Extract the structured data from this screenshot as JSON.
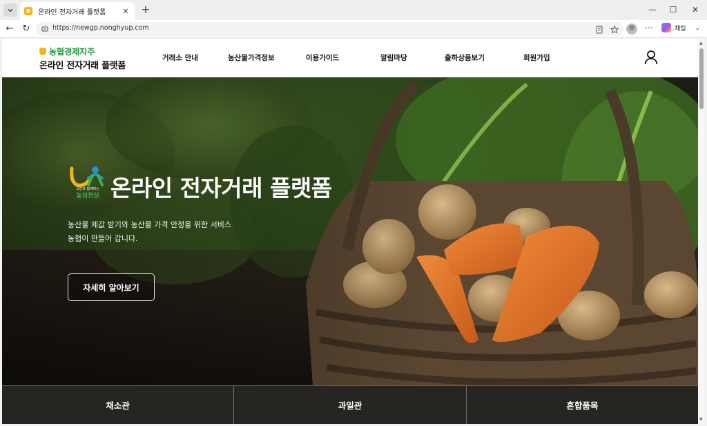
{
  "browser": {
    "tab_title": "온라인 전자거래 플랫폼",
    "url": "https://newgp.nonghyup.com",
    "copilot_label": "채팅"
  },
  "header": {
    "logo_top": "농협경제지주",
    "logo_bottom": "온라인 전자거래 플랫폼",
    "nav": [
      {
        "label": "거래소 안내"
      },
      {
        "label": "농산물가격정보"
      },
      {
        "label": "이용가이드"
      },
      {
        "label": "알림마당"
      },
      {
        "label": "출하상품보기"
      },
      {
        "label": "회원가입"
      }
    ]
  },
  "hero": {
    "logo_sub": "국민과 함께하는",
    "logo_name": "농심천심",
    "title": "온라인 전자거래 플랫폼",
    "desc_line1": "농산물 제값 받기와 농산물 가격 안정을 위한 서비스",
    "desc_line2": "농협이 만들어 갑니다.",
    "button_label": "자세히 알아보기"
  },
  "categories": [
    {
      "label": "채소관"
    },
    {
      "label": "과일관"
    },
    {
      "label": "혼합품목"
    }
  ],
  "colors": {
    "brand_green": "#1f9a3c",
    "brand_yellow": "#f2b51a"
  }
}
